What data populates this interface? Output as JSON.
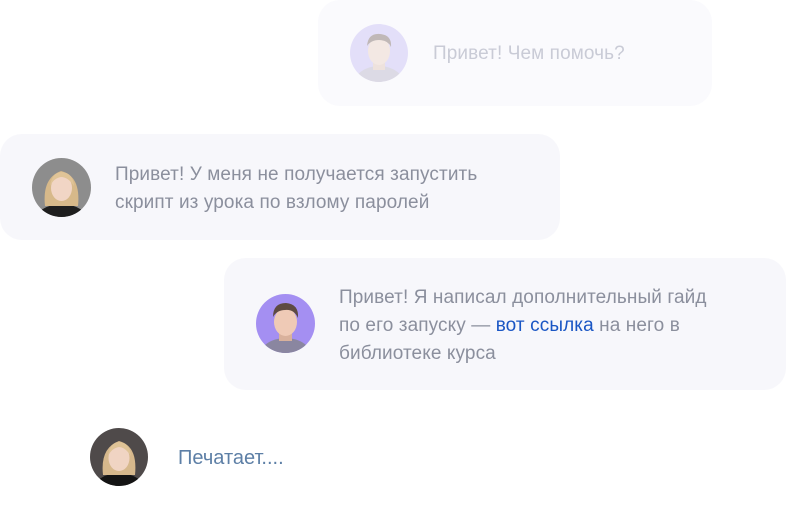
{
  "messages": [
    {
      "author": "support",
      "text": "Привет! Чем помочь?"
    },
    {
      "author": "student",
      "lines": [
        "Привет! У меня не получается запустить",
        "скрипт из урока по взлому паролей"
      ]
    },
    {
      "author": "support",
      "line1": "Привет! Я написал дополнительный гайд",
      "line2_before": "по его запуску — ",
      "link_text": "вот ссылка",
      "line2_after": " на него в",
      "line3": "библиотеке курса"
    }
  ],
  "typing": {
    "text": "Печатает...."
  },
  "colors": {
    "bubble": "#f7f7fb",
    "text": "#8b8f9d",
    "link": "#1a56c4",
    "typing": "#5d7fa6"
  },
  "icons": {
    "support_avatar": "man-avatar-icon",
    "student_avatar": "woman-avatar-icon"
  }
}
